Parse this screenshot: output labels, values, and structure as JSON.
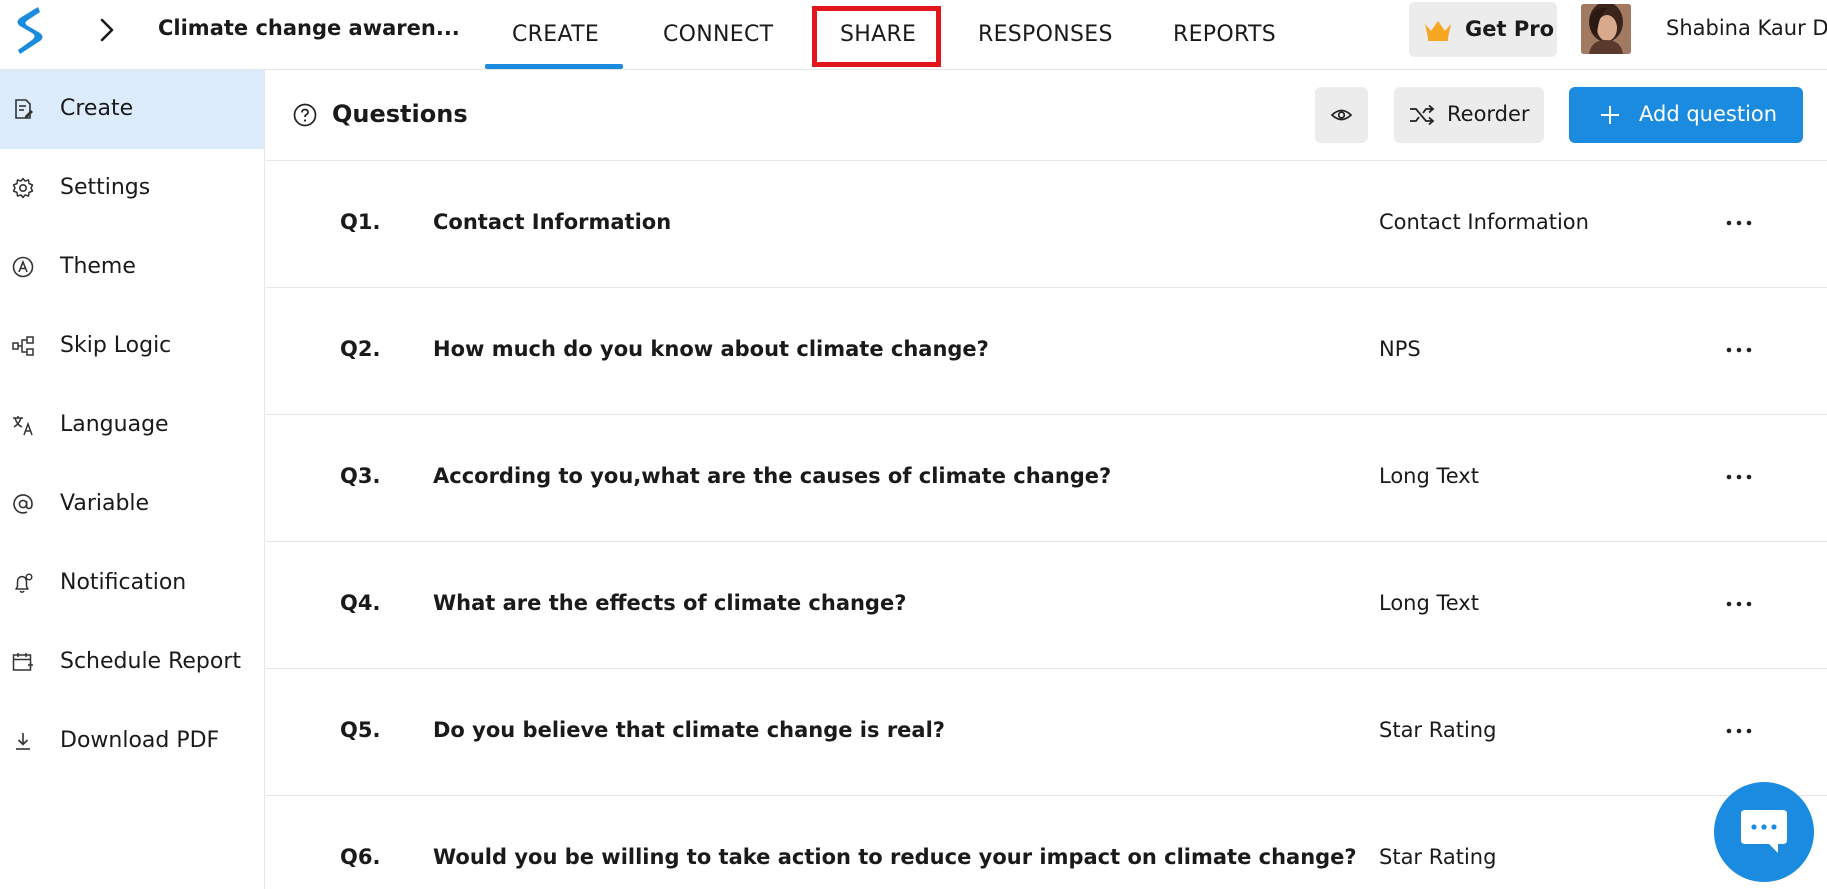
{
  "header": {
    "form_title": "Climate change awaren...",
    "tabs": [
      {
        "label": "CREATE"
      },
      {
        "label": "CONNECT"
      },
      {
        "label": "SHARE"
      },
      {
        "label": "RESPONSES"
      },
      {
        "label": "REPORTS"
      }
    ],
    "active_tab": "CREATE",
    "get_pro_label": "Get Pro",
    "user_name": "Shabina Kaur Dh"
  },
  "sidebar": {
    "items": [
      {
        "label": "Create",
        "icon": "form-edit-icon"
      },
      {
        "label": "Settings",
        "icon": "gear-icon"
      },
      {
        "label": "Theme",
        "icon": "theme-icon"
      },
      {
        "label": "Skip Logic",
        "icon": "skip-logic-icon"
      },
      {
        "label": "Language",
        "icon": "translate-icon"
      },
      {
        "label": "Variable",
        "icon": "at-icon"
      },
      {
        "label": "Notification",
        "icon": "bell-icon"
      },
      {
        "label": "Schedule Report",
        "icon": "calendar-icon"
      },
      {
        "label": "Download PDF",
        "icon": "download-icon"
      }
    ]
  },
  "main": {
    "title": "Questions",
    "reorder_label": "Reorder",
    "add_question_label": "Add question",
    "questions": [
      {
        "num": "Q1.",
        "text": "Contact Information",
        "type": "Contact Information"
      },
      {
        "num": "Q2.",
        "text": "How much do you know about climate change?",
        "type": "NPS"
      },
      {
        "num": "Q3.",
        "text": "According to you,what are the causes of climate change?",
        "type": "Long Text"
      },
      {
        "num": "Q4.",
        "text": "What are the effects of climate change?",
        "type": "Long Text"
      },
      {
        "num": "Q5.",
        "text": "Do you believe that climate change is real?",
        "type": "Star Rating"
      },
      {
        "num": "Q6.",
        "text": "Would you be willing to take action to reduce your impact on climate change?",
        "type": "Star Rating"
      }
    ]
  },
  "colors": {
    "accent": "#1b8be0",
    "highlight_box": "#e3161b",
    "active_sidebar_bg": "#dcecfc",
    "crown": "#f5a623"
  }
}
